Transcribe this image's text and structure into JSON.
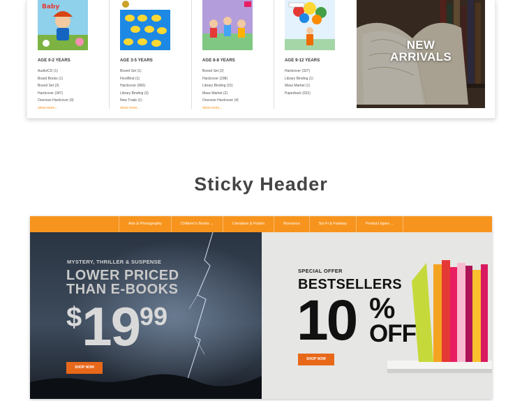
{
  "mega_menu": {
    "columns": [
      {
        "heading": "AGE 0-2 YEARS",
        "book_alt": "Baby on the Farm",
        "items": [
          "Audio/CD (1)",
          "Board Books (1)",
          "Boxed Set (3)",
          "Hardcover (347)",
          "Oversize Hardcover (9)"
        ],
        "more": "show more..."
      },
      {
        "heading": "AGE 3-5 YEARS",
        "book_alt": "10 Little Rubber Ducks",
        "items": [
          "Boxed Set (1)",
          "FlexiBind (1)",
          "Hardcover (960)",
          "Library Binding (3)",
          "New Trade (1)"
        ],
        "more": "show more..."
      },
      {
        "heading": "AGE 6-8 YEARS",
        "book_alt": "Children's picture book",
        "items": [
          "Boxed Set (2)",
          "Hardcover (298)",
          "Library Binding (15)",
          "Mass Market (2)",
          "Oversize Hardcover (4)"
        ],
        "more": "show more..."
      },
      {
        "heading": "AGE 9-12 YEARS",
        "book_alt": "10 Birthdays",
        "items": [
          "Hardcover (327)",
          "Library Binding (1)",
          "Mass Market (1)",
          "Paperback (631)"
        ],
        "more": ""
      }
    ],
    "promo": {
      "line1": "NEW",
      "line2": "ARRIVALS"
    }
  },
  "section_title": "Sticky Header",
  "demo": {
    "nav": [
      {
        "label": "Arts & Photography",
        "dropdown": false
      },
      {
        "label": "Children's Books",
        "dropdown": true
      },
      {
        "label": "Literature & Fiction",
        "dropdown": false
      },
      {
        "label": "Romance",
        "dropdown": false
      },
      {
        "label": "Sci-Fi & Fantasy",
        "dropdown": false
      },
      {
        "label": "Product types",
        "dropdown": true
      }
    ],
    "hero_left": {
      "kicker": "MYSTERY, THRILLER & SUSPENSE",
      "title_line1": "LOWER PRICED",
      "title_line2": "THAN E-BOOKS",
      "currency": "$",
      "price": "19",
      "cents": "99",
      "button": "SHOP NOW"
    },
    "hero_right": {
      "kicker": "SPECIAL OFFER",
      "title": "BESTSELLERS",
      "value": "10",
      "pct": "%",
      "off": "OFF",
      "button": "SHOP NOW"
    }
  },
  "colors": {
    "accent": "#f7941d",
    "button": "#e8681a"
  }
}
